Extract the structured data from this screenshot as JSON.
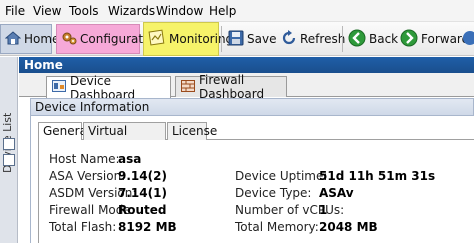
{
  "menu": [
    "File",
    "View",
    "Tools",
    "Wizards",
    "Window",
    "Help"
  ],
  "toolbar": {
    "home": "Home",
    "configuration": "Configuration",
    "monitoring": "Monitoring",
    "save": "Save",
    "refresh": "Refresh",
    "back": "Back",
    "forward": "Forward"
  },
  "sidebar": {
    "device_list_label": "Device List"
  },
  "home_header": "Home",
  "dashboard_tabs": [
    "Device Dashboard",
    "Firewall Dashboard"
  ],
  "device_info": {
    "title": "Device Information",
    "tabs": [
      "General",
      "Virtual Resources",
      "License"
    ],
    "left": [
      {
        "label": "Host Name:",
        "value": "asa"
      },
      {
        "label": "ASA Version:",
        "value": "9.14(2)"
      },
      {
        "label": "ASDM Version:",
        "value": "7.14(1)"
      },
      {
        "label": "Firewall Mode:",
        "value": "Routed"
      },
      {
        "label": "Total Flash:",
        "value": "8192 MB"
      }
    ],
    "right": [
      {
        "label": "Device Uptime:",
        "value": "51d 11h 51m 31s"
      },
      {
        "label": "Device Type:",
        "value": "ASAv"
      },
      {
        "label": "Number of vCPUs:",
        "value": "1"
      },
      {
        "label": "Total Memory:",
        "value": "2048 MB"
      }
    ]
  },
  "colors": {
    "configuration_highlight": "#f6a9d8",
    "monitoring_highlight": "#f6f36a",
    "home_header_bg": "#1f5fa8"
  }
}
